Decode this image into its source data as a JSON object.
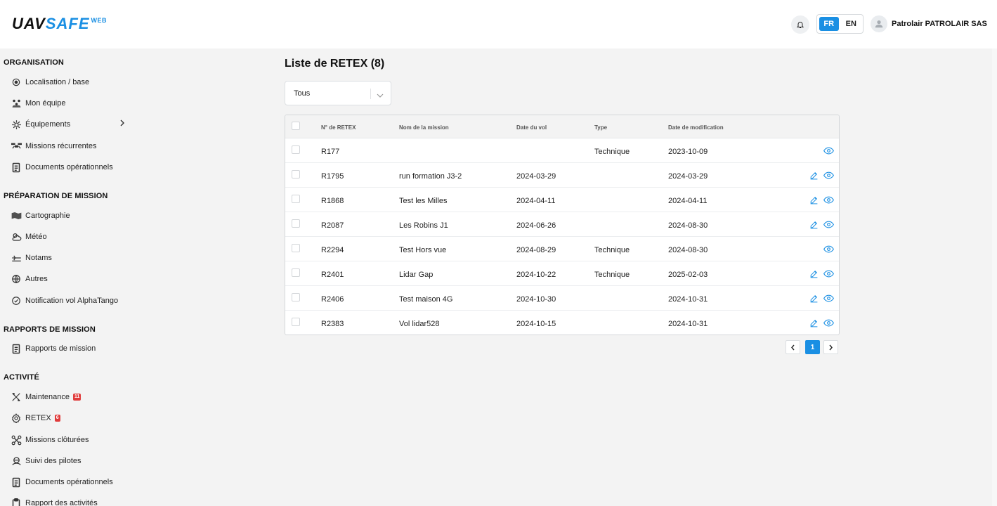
{
  "header": {
    "logo_main": "UAVSAFE",
    "logo_sup": "WEB",
    "lang_fr": "FR",
    "lang_en": "EN",
    "username": "Patrolair PATROLAIR SAS"
  },
  "sidebar": {
    "sections": [
      {
        "title": "ORGANISATION"
      },
      {
        "title": "PRÉPARATION DE MISSION"
      },
      {
        "title": "RAPPORTS DE MISSION"
      },
      {
        "title": "ACTIVITÉ"
      }
    ],
    "items": [
      {
        "label": "Localisation / base",
        "icon": "location-target-icon"
      },
      {
        "label": "Mon équipe",
        "icon": "team-icon"
      },
      {
        "label": "Équipements",
        "icon": "equipment-gear-icon"
      },
      {
        "label": "Missions récurrentes",
        "icon": "drone-icon"
      },
      {
        "label": "Documents opérationnels",
        "icon": "document-icon"
      },
      {
        "label": "Cartographie",
        "icon": "map-icon"
      },
      {
        "label": "Météo",
        "icon": "weather-icon"
      },
      {
        "label": "Notams",
        "icon": "notam-icon"
      },
      {
        "label": "Autres",
        "icon": "globe-icon"
      },
      {
        "label": "Notification vol AlphaTango",
        "icon": "notification-flight-icon"
      },
      {
        "label": "Rapports de mission",
        "icon": "report-icon"
      },
      {
        "label": "Maintenance",
        "icon": "tools-icon",
        "badge": "11"
      },
      {
        "label": "RETEX",
        "icon": "retex-gear-icon",
        "badge": "6"
      },
      {
        "label": "Missions clôturées",
        "icon": "drone-closed-icon"
      },
      {
        "label": "Suivi des pilotes",
        "icon": "pilots-icon"
      },
      {
        "label": "Documents opérationnels",
        "icon": "document-icon"
      },
      {
        "label": "Rapport des activités",
        "icon": "clipboard-icon"
      }
    ]
  },
  "main": {
    "title": "Liste de RETEX (8)",
    "filter_value": "Tous",
    "columns": [
      "N° de RETEX",
      "Nom de la mission",
      "Date du vol",
      "Type",
      "Date de modification"
    ],
    "rows": [
      {
        "id": "R177",
        "mission": "",
        "date_vol": "",
        "type": "Technique",
        "date_mod": "2023-10-09",
        "editable": false
      },
      {
        "id": "R1795",
        "mission": "run formation J3-2",
        "date_vol": "2024-03-29",
        "type": "",
        "date_mod": "2024-03-29",
        "editable": true
      },
      {
        "id": "R1868",
        "mission": "Test les Milles",
        "date_vol": "2024-04-11",
        "type": "",
        "date_mod": "2024-04-11",
        "editable": true
      },
      {
        "id": "R2087",
        "mission": "Les Robins J1",
        "date_vol": "2024-06-26",
        "type": "",
        "date_mod": "2024-08-30",
        "editable": true
      },
      {
        "id": "R2294",
        "mission": "Test Hors vue",
        "date_vol": "2024-08-29",
        "type": "Technique",
        "date_mod": "2024-08-30",
        "editable": false
      },
      {
        "id": "R2401",
        "mission": "Lidar Gap",
        "date_vol": "2024-10-22",
        "type": "Technique",
        "date_mod": "2025-02-03",
        "editable": true
      },
      {
        "id": "R2406",
        "mission": "Test maison 4G",
        "date_vol": "2024-10-30",
        "type": "",
        "date_mod": "2024-10-31",
        "editable": true
      },
      {
        "id": "R2383",
        "mission": "Vol lidar528",
        "date_vol": "2024-10-15",
        "type": "",
        "date_mod": "2024-10-31",
        "editable": true
      }
    ],
    "pagination": {
      "current": "1"
    }
  },
  "colors": {
    "accent": "#1a8fe3",
    "badge": "#e03b3b"
  }
}
